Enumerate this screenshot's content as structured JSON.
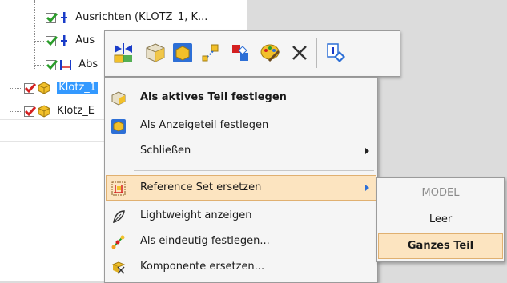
{
  "tree": {
    "rows": [
      {
        "label": "Ausrichten (KLOTZ_1, K..."
      },
      {
        "label": "Aus"
      },
      {
        "label": "Abs"
      },
      {
        "label": "Klotz_1"
      },
      {
        "label": "Klotz_E"
      }
    ]
  },
  "toolbar": {
    "buttons": [
      "mirror-icon",
      "make-work-part-icon",
      "make-display-part-icon",
      "replace-icon",
      "reference-set-icon",
      "edit-display-icon",
      "delete-icon",
      "properties-icon"
    ]
  },
  "menu": {
    "items": [
      {
        "label": "Als aktives Teil festlegen",
        "icon": "work-part-icon",
        "bold": true
      },
      {
        "label": "Als Anzeigeteil festlegen",
        "icon": "display-part-icon"
      },
      {
        "label": "Schließen",
        "has_submenu": true
      },
      {
        "label": "Reference Set ersetzen",
        "icon": "reference-set-icon",
        "has_submenu": true,
        "highlighted": true
      },
      {
        "label": "Lightweight anzeigen",
        "icon": "lightweight-icon"
      },
      {
        "label": "Als eindeutig festlegen...",
        "icon": "make-unique-icon"
      },
      {
        "label": "Komponente ersetzen...",
        "icon": "replace-component-icon"
      }
    ]
  },
  "submenu": {
    "items": [
      {
        "label": "MODEL",
        "disabled": true
      },
      {
        "label": "Leer"
      },
      {
        "label": "Ganzes Teil",
        "highlighted": true
      }
    ]
  },
  "colors": {
    "selection": "#3399ff",
    "menu_highlight": "#fce4c0",
    "check_green": "#2a9d2a",
    "check_red": "#d42020",
    "cube_yellow": "#f2c02a"
  }
}
